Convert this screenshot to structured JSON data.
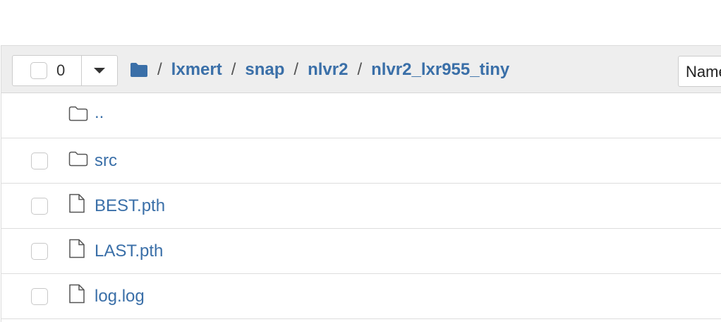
{
  "toolbar": {
    "selected_count": "0",
    "sort_label": "Name"
  },
  "breadcrumb": {
    "separator": "/",
    "items": [
      "lxmert",
      "snap",
      "nlvr2",
      "nlvr2_lxr955_tiny"
    ]
  },
  "files": [
    {
      "name": "..",
      "type": "parent-folder"
    },
    {
      "name": "src",
      "type": "folder"
    },
    {
      "name": "BEST.pth",
      "type": "file"
    },
    {
      "name": "LAST.pth",
      "type": "file"
    },
    {
      "name": "log.log",
      "type": "file"
    }
  ],
  "colors": {
    "link": "#3a6fa8",
    "header_bg": "#eeeeee"
  }
}
